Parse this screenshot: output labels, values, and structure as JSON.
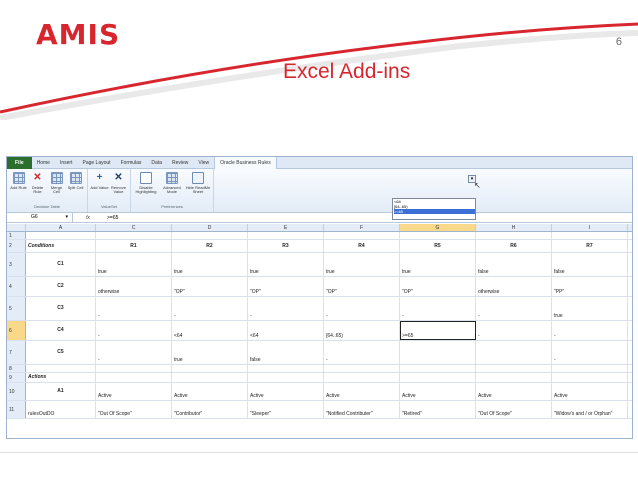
{
  "slide": {
    "logo": "AMIS",
    "page_number": "6",
    "title": "Excel Add-ins",
    "colors": {
      "accent": "#d8262f",
      "swoosh": "#d8262f"
    }
  },
  "excel": {
    "tabs": [
      "File",
      "Home",
      "Insert",
      "Page Layout",
      "Formulas",
      "Data",
      "Review",
      "View",
      "Oracle Business Rules"
    ],
    "active_tab": "Oracle Business Rules",
    "ribbon_groups": [
      {
        "label": "Decision Table",
        "buttons": [
          {
            "label": "Add Rule",
            "icon": "table-add-icon"
          },
          {
            "label": "Delete Rule",
            "icon": "delete-icon"
          },
          {
            "label": "Merge Cell",
            "icon": "merge-icon"
          },
          {
            "label": "Split Cell",
            "icon": "split-icon"
          }
        ]
      },
      {
        "label": "ValueSet",
        "buttons": [
          {
            "label": "Add Value",
            "icon": "add-value-icon"
          },
          {
            "label": "Remove Value",
            "icon": "remove-value-icon"
          }
        ]
      },
      {
        "label": "Preferences",
        "buttons": [
          {
            "label": "Disable Highlighting",
            "icon": "highlight-icon"
          },
          {
            "label": "Advanced Mode",
            "icon": "advanced-mode-icon"
          },
          {
            "label": "Hide ReadMe Sheet",
            "icon": "sheet-icon"
          }
        ]
      }
    ],
    "name_box": "G6",
    "fx": "fx",
    "formula_value": ">=65",
    "columns": [
      "A",
      "C",
      "D",
      "E",
      "F",
      "G",
      "H",
      "I"
    ],
    "selected_column": "G",
    "rows": [
      {
        "n": "1",
        "cells": [
          "",
          "",
          "",
          "",
          "",
          "",
          "",
          ""
        ]
      },
      {
        "n": "2",
        "cells": [
          "Conditions",
          "R1",
          "R2",
          "R3",
          "R4",
          "R5",
          "R6",
          "R7"
        ]
      },
      {
        "n": "3",
        "cells": [
          "C1",
          "true",
          "true",
          "true",
          "true",
          "true",
          "false",
          "false"
        ]
      },
      {
        "n": "4",
        "cells": [
          "C2",
          "otherwise",
          "\"OP\"",
          "\"OP\"",
          "\"OP\"",
          "\"OP\"",
          "otherwise",
          "\"PP\""
        ]
      },
      {
        "n": "5",
        "cells": [
          "C3",
          "-",
          "-",
          "-",
          "-",
          "-",
          "-",
          "true"
        ]
      },
      {
        "n": "6",
        "cells": [
          "C4",
          "-",
          "<64",
          "<64",
          "[64..65)",
          ">=65",
          "-",
          "-"
        ]
      },
      {
        "n": "7",
        "cells": [
          "C5",
          "-",
          "true",
          "false",
          "-",
          "",
          "",
          "-"
        ]
      },
      {
        "n": "8",
        "cells": [
          "",
          "",
          "",
          "",
          "",
          "",
          "",
          ""
        ]
      },
      {
        "n": "9",
        "cells": [
          "Actions",
          "",
          "",
          "",
          "",
          "",
          "",
          ""
        ]
      },
      {
        "n": "10",
        "cells": [
          "A1",
          "Active",
          "Active",
          "Active",
          "Active",
          "Active",
          "Active",
          "Active"
        ]
      },
      {
        "n": "11",
        "cells": [
          "rulesOutDO",
          "\"Out Of Scope\"",
          "\"Contributor\"",
          "\"Sleeper\"",
          "\"Notified Contributer\"",
          "\"Retired\"",
          "\"Out Of Scope\"",
          "\"Widow's and / or Orphan\""
        ]
      }
    ],
    "selected_row": "6",
    "dropdown_options": [
      "<64",
      "[64..65)",
      ">=65"
    ],
    "dropdown_selected": ">=65"
  }
}
